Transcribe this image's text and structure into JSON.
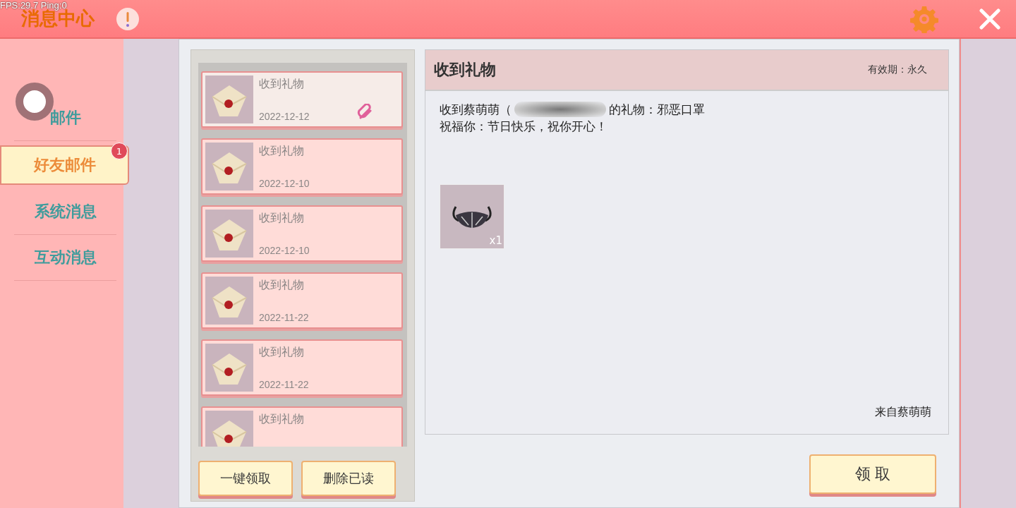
{
  "debug_overlay": "FPS:29.7  Ping:0",
  "header": {
    "title": "消息中心"
  },
  "sidebar": {
    "items": [
      {
        "label": "邮件",
        "selected": false
      },
      {
        "label": "好友邮件",
        "selected": true,
        "badge": "1"
      },
      {
        "label": "系统消息",
        "selected": false
      },
      {
        "label": "互动消息",
        "selected": false
      }
    ]
  },
  "mail_list": {
    "items": [
      {
        "title": "收到礼物",
        "date": "2022-12-12",
        "selected": true,
        "attachment": true
      },
      {
        "title": "收到礼物",
        "date": "2022-12-10",
        "selected": false,
        "attachment": false
      },
      {
        "title": "收到礼物",
        "date": "2022-12-10",
        "selected": false,
        "attachment": false
      },
      {
        "title": "收到礼物",
        "date": "2022-11-22",
        "selected": false,
        "attachment": false
      },
      {
        "title": "收到礼物",
        "date": "2022-11-22",
        "selected": false,
        "attachment": false
      },
      {
        "title": "收到礼物",
        "selected": false,
        "attachment": false
      }
    ],
    "buttons": [
      "一键领取",
      "删除已读"
    ]
  },
  "detail": {
    "title": "收到礼物",
    "validity": "有效期：永久",
    "body_before": "收到蔡萌萌（",
    "body_after": "的礼物：邪恶口罩",
    "line2": "祝福你：节日快乐，祝你开心！",
    "attachments": [
      {
        "count": "x1"
      }
    ],
    "sender": "来自蔡萌萌",
    "claim_button": "领 取"
  }
}
